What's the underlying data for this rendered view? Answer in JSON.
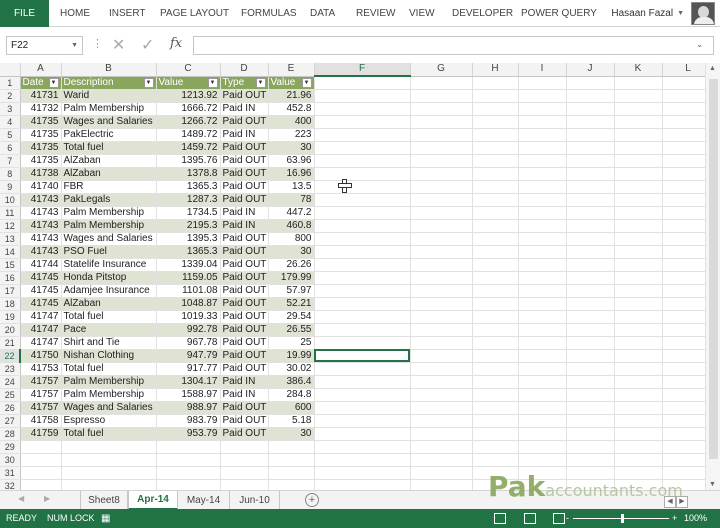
{
  "ribbon": {
    "file": "FILE",
    "tabs": [
      "HOME",
      "INSERT",
      "PAGE LAYOUT",
      "FORMULAS",
      "DATA",
      "REVIEW",
      "VIEW",
      "DEVELOPER",
      "POWER QUERY"
    ],
    "user": "Hasaan Fazal"
  },
  "formula_bar": {
    "name_box": "F22",
    "fx": "fx",
    "value": ""
  },
  "columns": [
    "A",
    "B",
    "C",
    "D",
    "E",
    "F",
    "G",
    "H",
    "I",
    "J",
    "K",
    "L"
  ],
  "selected": {
    "col": "F",
    "row": 22
  },
  "table": {
    "headers": [
      "Date",
      "Description",
      "Value",
      "Type",
      "Value"
    ],
    "rows": [
      [
        "41731",
        "Warid",
        "1213.92",
        "Paid OUT",
        "21.96"
      ],
      [
        "41732",
        "Palm Membership",
        "1666.72",
        "Paid IN",
        "452.8"
      ],
      [
        "41735",
        "Wages and Salaries",
        "1266.72",
        "Paid OUT",
        "400"
      ],
      [
        "41735",
        "PakElectric",
        "1489.72",
        "Paid IN",
        "223"
      ],
      [
        "41735",
        "Total fuel",
        "1459.72",
        "Paid OUT",
        "30"
      ],
      [
        "41735",
        "AlZaban",
        "1395.76",
        "Paid OUT",
        "63.96"
      ],
      [
        "41738",
        "AlZaban",
        "1378.8",
        "Paid OUT",
        "16.96"
      ],
      [
        "41740",
        "FBR",
        "1365.3",
        "Paid OUT",
        "13.5"
      ],
      [
        "41743",
        "PakLegals",
        "1287.3",
        "Paid OUT",
        "78"
      ],
      [
        "41743",
        "Palm Membership",
        "1734.5",
        "Paid IN",
        "447.2"
      ],
      [
        "41743",
        "Palm Membership",
        "2195.3",
        "Paid IN",
        "460.8"
      ],
      [
        "41743",
        "Wages and Salaries",
        "1395.3",
        "Paid OUT",
        "800"
      ],
      [
        "41743",
        "PSO Fuel",
        "1365.3",
        "Paid OUT",
        "30"
      ],
      [
        "41744",
        "Statelife Insurance",
        "1339.04",
        "Paid OUT",
        "26.26"
      ],
      [
        "41745",
        "Honda Pitstop",
        "1159.05",
        "Paid OUT",
        "179.99"
      ],
      [
        "41745",
        "Adamjee Insurance",
        "1101.08",
        "Paid OUT",
        "57.97"
      ],
      [
        "41745",
        "AlZaban",
        "1048.87",
        "Paid OUT",
        "52.21"
      ],
      [
        "41747",
        "Total fuel",
        "1019.33",
        "Paid OUT",
        "29.54"
      ],
      [
        "41747",
        "Pace",
        "992.78",
        "Paid OUT",
        "26.55"
      ],
      [
        "41747",
        "Shirt and Tie",
        "967.78",
        "Paid OUT",
        "25"
      ],
      [
        "41750",
        "Nishan Clothing",
        "947.79",
        "Paid OUT",
        "19.99"
      ],
      [
        "41753",
        "Total fuel",
        "917.77",
        "Paid OUT",
        "30.02"
      ],
      [
        "41757",
        "Palm Membership",
        "1304.17",
        "Paid IN",
        "386.4"
      ],
      [
        "41757",
        "Palm Membership",
        "1588.97",
        "Paid IN",
        "284.8"
      ],
      [
        "41757",
        "Wages and Salaries",
        "988.97",
        "Paid OUT",
        "600"
      ],
      [
        "41758",
        "Espresso",
        "983.79",
        "Paid OUT",
        "5.18"
      ],
      [
        "41759",
        "Total fuel",
        "953.79",
        "Paid OUT",
        "30"
      ]
    ],
    "extra_row_numbers": [
      "29",
      "30",
      "31",
      "32"
    ]
  },
  "sheets": {
    "tabs": [
      "Sheet8",
      "Apr-14",
      "May-14",
      "Jun-10"
    ],
    "active": "Apr-14"
  },
  "watermark": {
    "part1": "Pak",
    "part2": "accountants.com"
  },
  "status": {
    "ready": "READY",
    "numlock": "NUM LOCK",
    "zoom": "100%",
    "minus": "-",
    "plus": "+"
  },
  "colors": {
    "accent": "#217346",
    "header_fill": "#8aa65c",
    "band_fill": "#dfe3d4"
  }
}
